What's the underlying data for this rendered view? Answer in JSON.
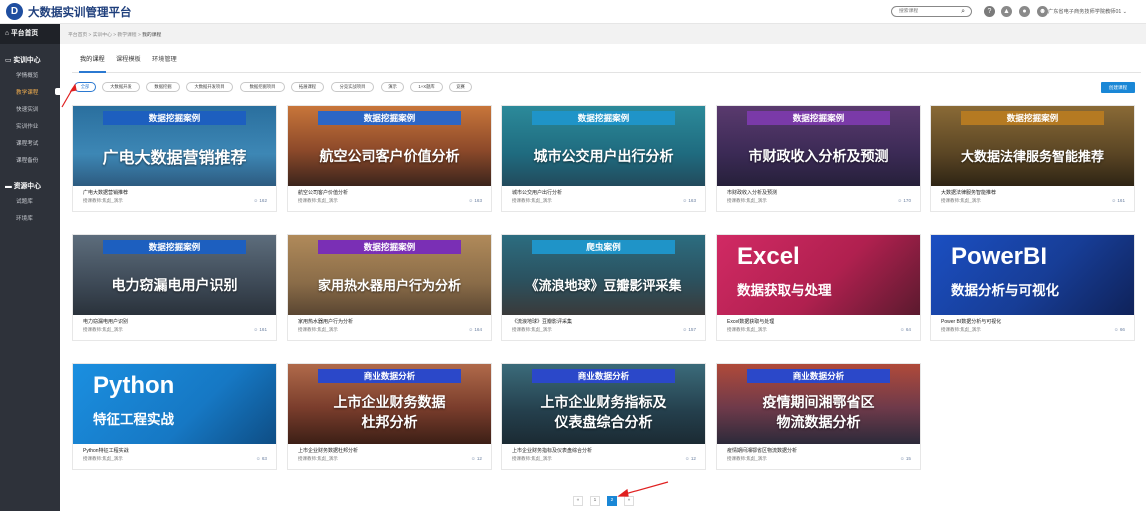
{
  "header": {
    "logo_mark": "D",
    "brand": "大数据实训管理平台",
    "search_placeholder": "搜索课程",
    "user_name": "广东省电子商务技师学院教师01"
  },
  "sidebar": {
    "home": "平台首页",
    "group1": "实训中心",
    "group1_items": [
      "学情概览",
      "教学课程",
      "快速实训",
      "实训作业",
      "课程考试",
      "课程备份"
    ],
    "group2": "资源中心",
    "group2_items": [
      "试题库",
      "环境库"
    ]
  },
  "breadcrumb": {
    "parts": [
      "平台首页",
      "实训中心",
      "教学课程"
    ],
    "current": "我的课程",
    "sep": ">"
  },
  "tabs": [
    "我的课程",
    "课程模板",
    "环境管理"
  ],
  "chips": [
    "全部",
    "大数据开发",
    "数据挖掘",
    "大数据开发项目",
    "数据挖掘项目",
    "拓展课程",
    "分竞实战项目",
    "演示",
    "1+X题库",
    "竞赛"
  ],
  "create_button": "创建课程",
  "teacher_label": "授课教师:",
  "courses": [
    {
      "caption": "数据挖掘案例",
      "banner": "广电大数据营销推荐",
      "title": "广电大数据营销推荐",
      "teacher": "焦彪_演示",
      "count": "162"
    },
    {
      "caption": "数据挖掘案例",
      "banner": "航空公司客户价值分析",
      "title": "航空公司客户价值分析",
      "teacher": "焦彪_演示",
      "count": "163"
    },
    {
      "caption": "数据挖掘案例",
      "banner": "城市公交用户出行分析",
      "title": "城市公交用户出行分析",
      "teacher": "焦彪_演示",
      "count": "163"
    },
    {
      "caption": "数据挖掘案例",
      "banner": "市财政收入分析及预测",
      "title": "市财政收入分析及预测",
      "teacher": "焦彪_演示",
      "count": "170"
    },
    {
      "caption": "数据挖掘案例",
      "banner": "大数据法律服务智能推荐",
      "title": "大数据法律服务智能推荐",
      "teacher": "焦彪_演示",
      "count": "161"
    },
    {
      "caption": "数据挖掘案例",
      "banner": "电力窃漏电用户识别",
      "title": "电力窃漏电用户识别",
      "teacher": "焦彪_演示",
      "count": "161"
    },
    {
      "caption": "数据挖掘案例",
      "banner": "家用热水器用户行为分析",
      "title": "家用热水器用户行为分析",
      "teacher": "焦彪_演示",
      "count": "164"
    },
    {
      "caption": "爬虫案例",
      "banner": "《流浪地球》豆瓣影评采集",
      "title": "《流浪地球》豆瓣影评采集",
      "teacher": "焦彪_演示",
      "count": "157"
    },
    {
      "big": "Excel",
      "banner": "数据获取与处理",
      "title": "Excel数据获取与处理",
      "teacher": "焦彪_演示",
      "count": "64"
    },
    {
      "big": "PowerBI",
      "banner": "数据分析与可视化",
      "title": "Power BI数据分析与可视化",
      "teacher": "焦彪_演示",
      "count": "66"
    },
    {
      "big": "Python",
      "banner": "特征工程实战",
      "title": "Python特征工程实战",
      "teacher": "焦彪_演示",
      "count": "63"
    },
    {
      "caption": "商业数据分析",
      "banner": "上市企业财务数据",
      "banner2": "杜邦分析",
      "title": "上市企业财务数据杜邦分析",
      "teacher": "焦彪_演示",
      "count": "12"
    },
    {
      "caption": "商业数据分析",
      "banner": "上市企业财务指标及",
      "banner2": "仪表盘综合分析",
      "title": "上市企业财务指标及仪表盘综合分析",
      "teacher": "焦彪_演示",
      "count": "12"
    },
    {
      "caption": "商业数据分析",
      "banner": "疫情期间湘鄂省区",
      "banner2": "物流数据分析",
      "title": "疫情期间湘鄂省区物流数据分析",
      "teacher": "焦彪_演示",
      "count": "15"
    }
  ],
  "pagination": {
    "prev": "«",
    "pages": [
      "1",
      "2"
    ],
    "next": "»",
    "current": "2"
  },
  "colors": {
    "primary": "#1a87d6",
    "sidebar": "#2e323a",
    "active_menu": "#f0ad4e",
    "arrow": "#e02020"
  }
}
